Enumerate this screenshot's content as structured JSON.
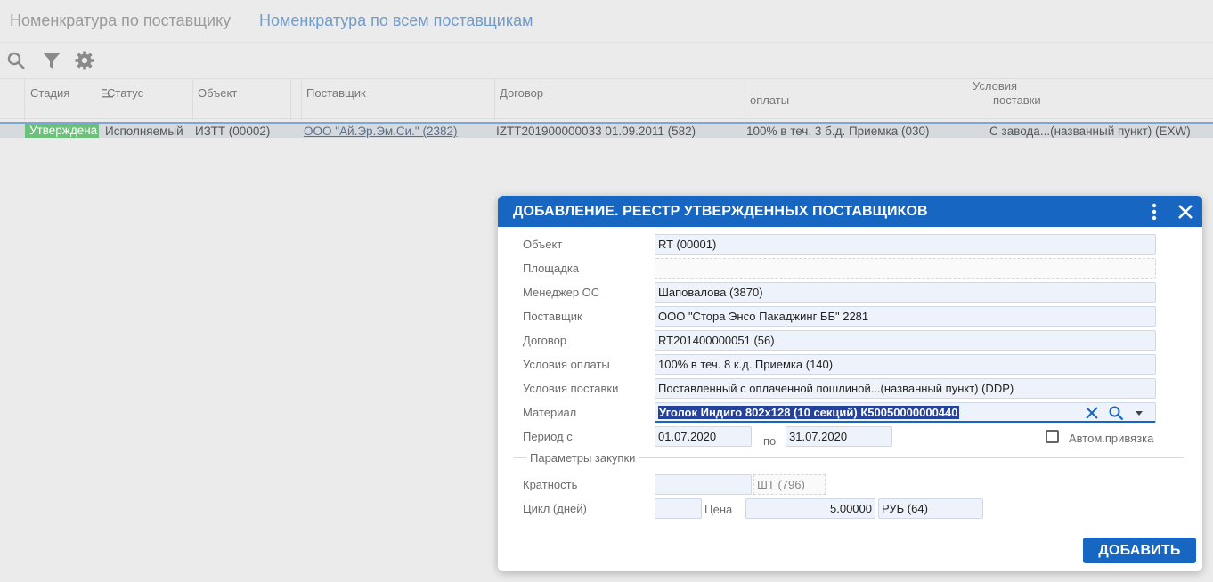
{
  "tabs": [
    {
      "label": "Номенкратура по поставщику"
    },
    {
      "label": "Номенкратура по всем поставщикам"
    }
  ],
  "toolbar": {
    "icons": [
      "search-icon",
      "filter-icon",
      "gear-icon"
    ]
  },
  "grid": {
    "columns": {
      "stage": "Стадия",
      "status": "Статус",
      "object": "Объект",
      "supplier": "Поставщик",
      "contract": "Договор",
      "conditions": "Условия",
      "payment": "оплаты",
      "delivery": "поставки"
    },
    "row": {
      "stage": "Утверждена",
      "status": "Исполняемый",
      "object": "ИЗТТ (00002)",
      "supplier": "ООО \"Ай.Эр.Эм.Си.\" (2382)",
      "contract": "IZTT201900000033 01.09.2011 (582)",
      "payment": "100% в теч. 3 б.д. Приемка (030)",
      "delivery": "С завода...(названный пункт) (EXW)"
    },
    "stage_color": "#6cc17a"
  },
  "dialog": {
    "title": "ДОБАВЛЕНИЕ. РЕЕСТР УТВЕРЖДЕННЫХ ПОСТАВЩИКОВ",
    "header_color": "#1767c2",
    "fields": {
      "object": {
        "label": "Объект",
        "value": "RT (00001)"
      },
      "site": {
        "label": "Площадка",
        "value": ""
      },
      "manager": {
        "label": "Менеджер ОС",
        "value": "Шаповалова (3870)"
      },
      "supplier": {
        "label": "Поставщик",
        "value": "ООО \"Стора Энсо Пакаджинг ББ\" 2281"
      },
      "contract": {
        "label": "Договор",
        "value": "RT201400000051 (56)"
      },
      "payment_terms": {
        "label": "Условия оплаты",
        "value": "100% в теч. 8 к.д. Приемка (140)"
      },
      "delivery_terms": {
        "label": "Условия поставки",
        "value": "Поставленный с оплаченной пошлиной...(названный пункт) (DDP)"
      },
      "material": {
        "label": "Материал",
        "value": "Уголок Индиго 802х128 (10 секций) К50050000000440"
      },
      "period": {
        "label": "Период с",
        "from": "01.07.2020",
        "to_label": "по",
        "to": "31.07.2020"
      },
      "auto_link": {
        "label": "Автом.привязка",
        "checked": false
      }
    },
    "purchase_section": {
      "title": "Параметры закупки",
      "multiplicity": {
        "label": "Кратность",
        "value": "",
        "unit": "ШТ (796)"
      },
      "cycle": {
        "label": "Цикл (дней)",
        "value": ""
      },
      "price": {
        "label": "Цена",
        "value": "5.00000",
        "currency": "РУБ (64)"
      }
    },
    "add_button": "ДОБАВИТЬ"
  }
}
